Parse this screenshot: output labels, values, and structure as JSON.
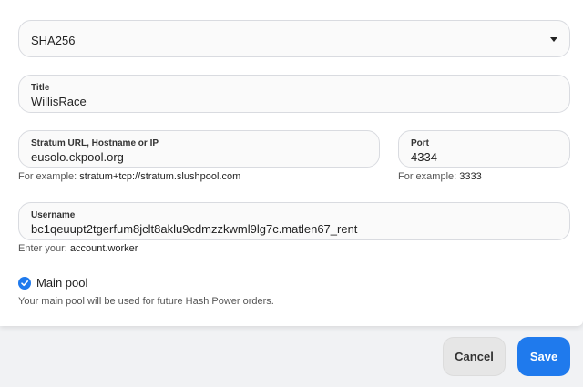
{
  "algorithm": {
    "value": "SHA256"
  },
  "title_field": {
    "label": "Title",
    "value": "WillisRace"
  },
  "url_field": {
    "label": "Stratum URL, Hostname or IP",
    "value": "eusolo.ckpool.org",
    "hint_prefix": "For example:",
    "hint_example": "stratum+tcp://stratum.slushpool.com"
  },
  "port_field": {
    "label": "Port",
    "value": "4334",
    "hint_prefix": "For example:",
    "hint_example": "3333"
  },
  "username_field": {
    "label": "Username",
    "value": "bc1qeuupt2tgerfum8jclt8aklu9cdmzzkwml9lg7c.matlen67_rent",
    "hint_prefix": "Enter your:",
    "hint_example": "account.worker"
  },
  "main_pool": {
    "checked": true,
    "label": "Main pool",
    "description": "Your main pool will be used for future Hash Power orders."
  },
  "buttons": {
    "cancel": "Cancel",
    "save": "Save"
  },
  "colors": {
    "accent": "#1f7aed",
    "cancel_bg": "#e6e6e6"
  }
}
